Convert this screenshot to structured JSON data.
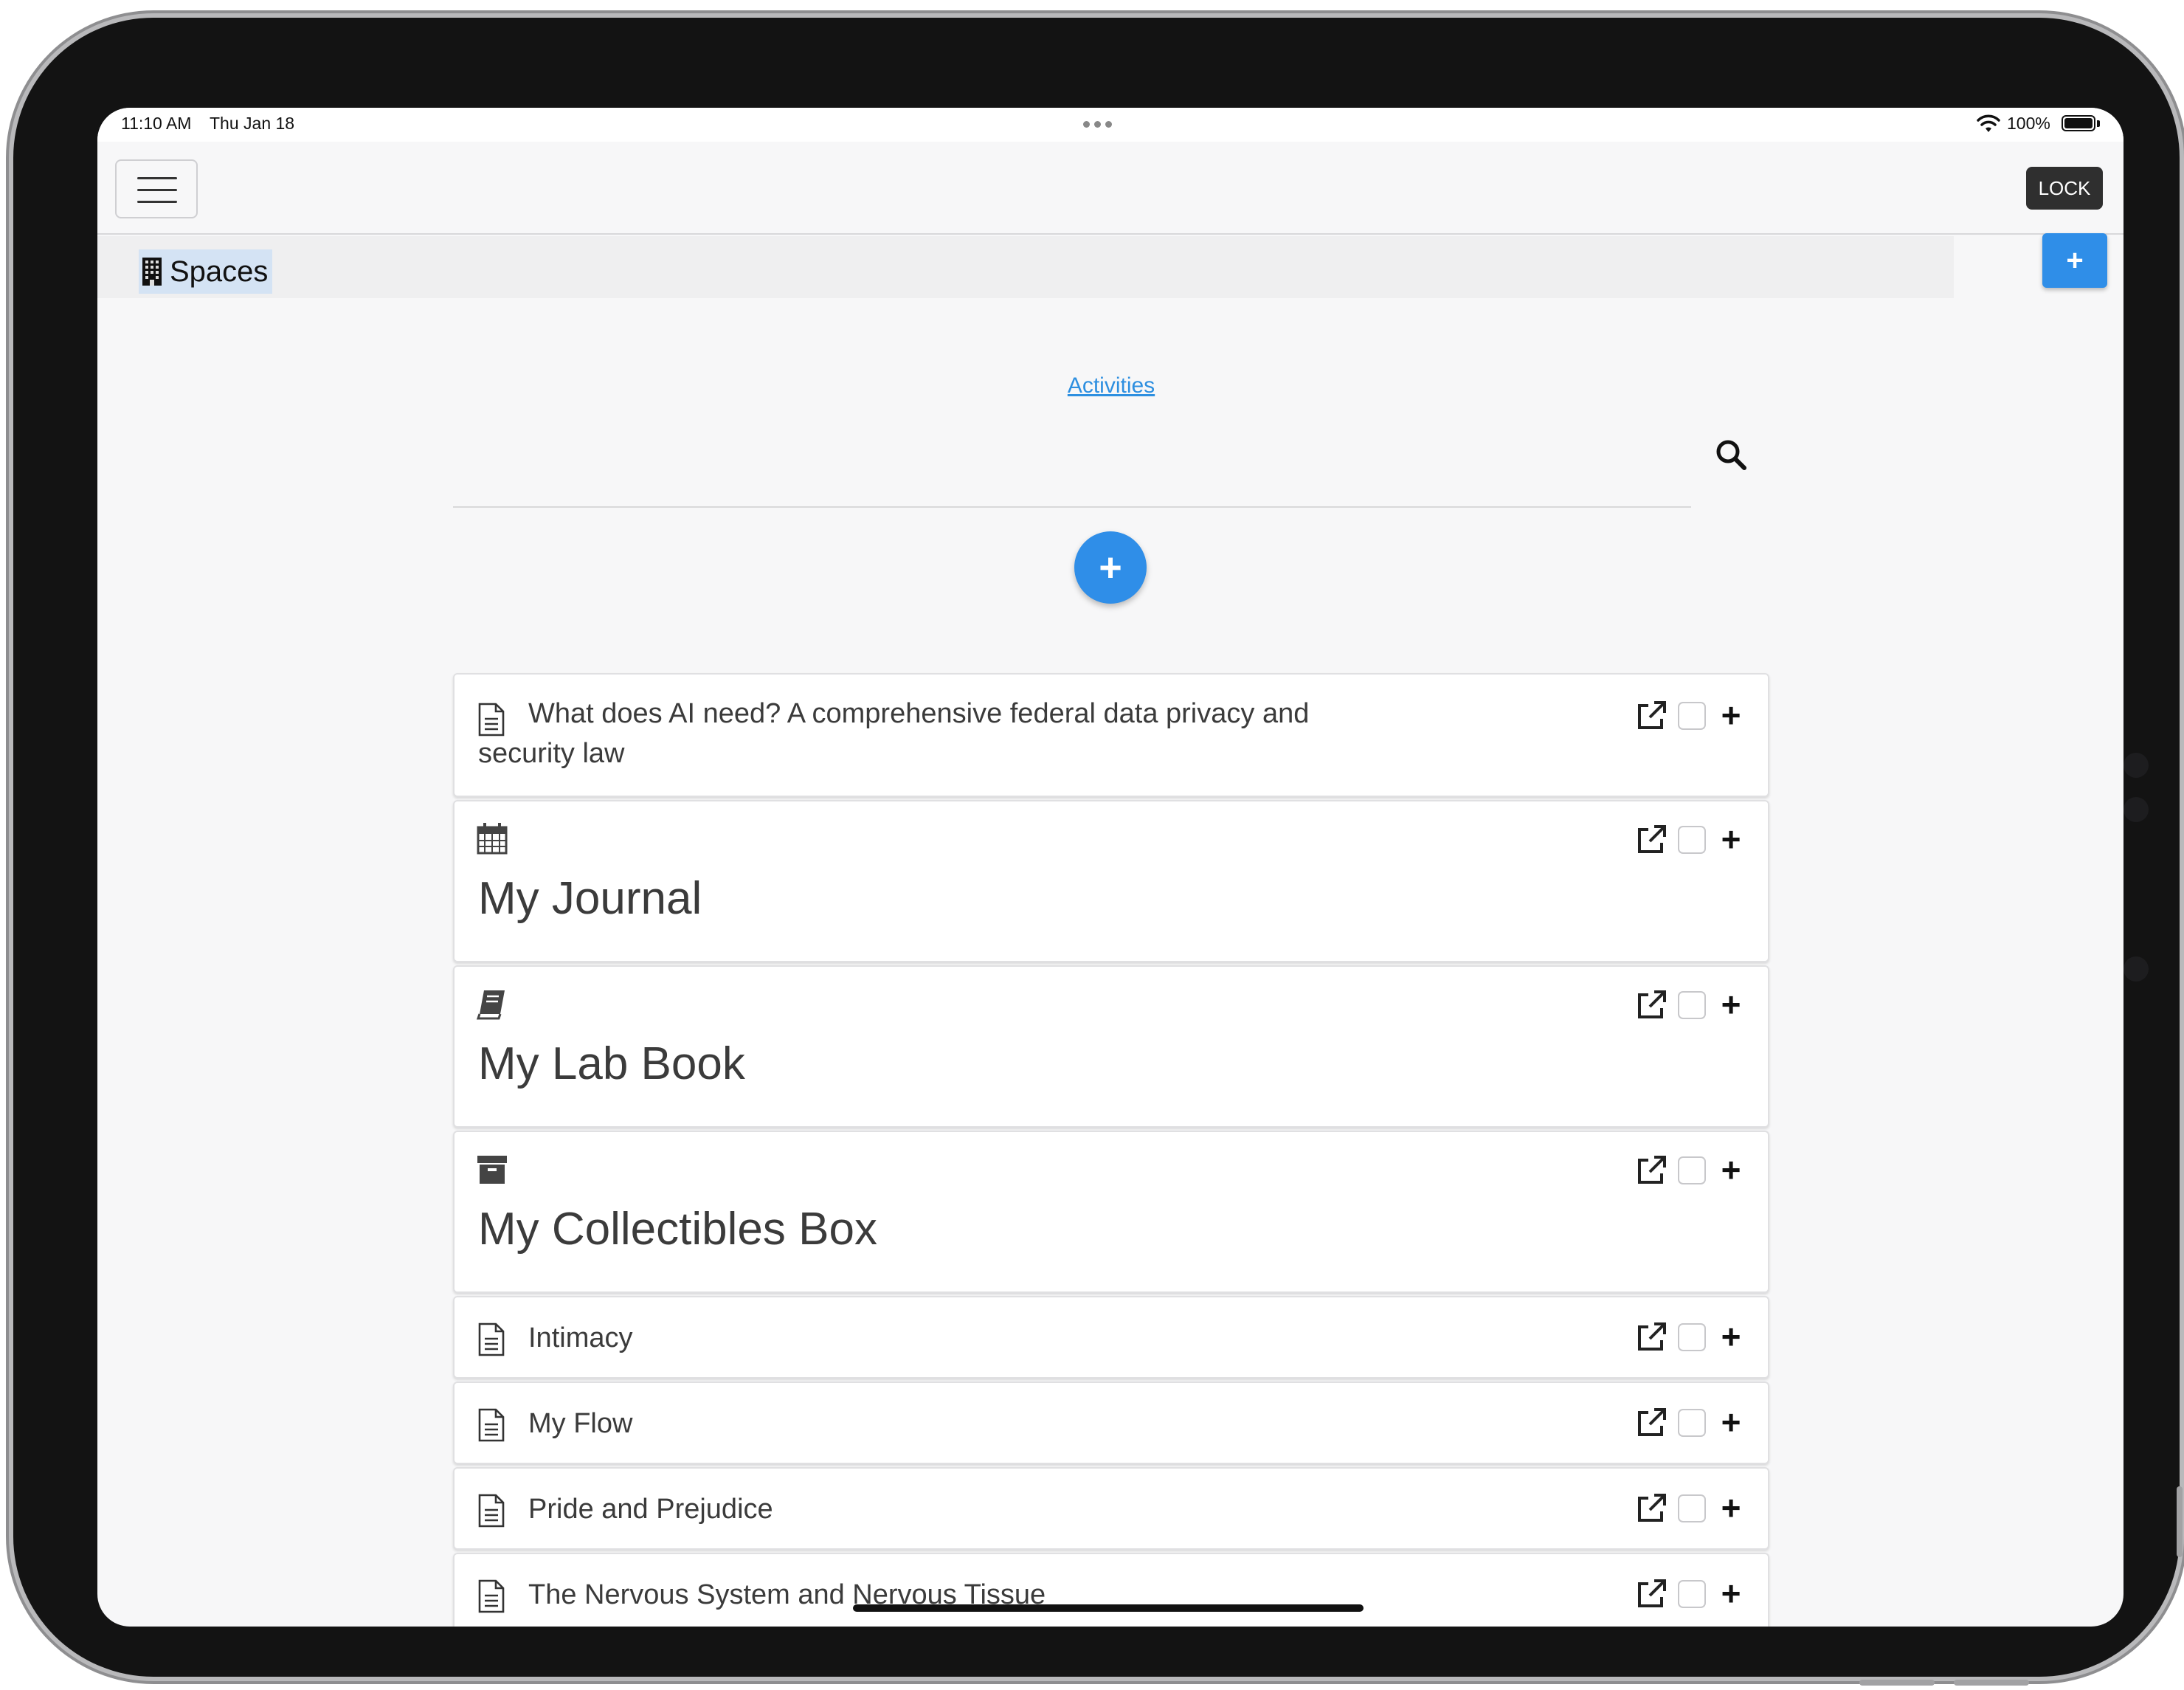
{
  "status_bar": {
    "time": "11:10 AM",
    "date": "Thu Jan 18",
    "battery": "100%",
    "wifi_icon": "wifi-icon",
    "battery_icon": "battery-icon"
  },
  "topbar": {
    "menu_icon": "hamburger-menu-icon",
    "lock_label": "LOCK"
  },
  "spaces": {
    "label": "Spaces",
    "icon": "building-icon",
    "add_label": "+"
  },
  "main": {
    "activities_link": "Activities",
    "search_icon": "search-icon",
    "add_label": "+"
  },
  "items": [
    {
      "type": "document",
      "icon": "document-icon",
      "title": "What does AI need? A comprehensive federal data privacy and security law"
    },
    {
      "type": "space",
      "icon": "calendar-icon",
      "title": "My Journal"
    },
    {
      "type": "space",
      "icon": "book-icon",
      "title": "My Lab Book"
    },
    {
      "type": "space",
      "icon": "archive-box-icon",
      "title": "My Collectibles Box"
    },
    {
      "type": "document",
      "icon": "document-icon",
      "title": "Intimacy"
    },
    {
      "type": "document",
      "icon": "document-icon",
      "title": "My Flow"
    },
    {
      "type": "document",
      "icon": "document-icon",
      "title": "Pride and Prejudice"
    },
    {
      "type": "document",
      "icon": "document-icon",
      "title": "The Nervous System and Nervous Tissue"
    }
  ],
  "item_actions": {
    "open_icon": "external-link-icon",
    "add_label": "+"
  },
  "colors": {
    "accent": "#2f8ee8",
    "lock_bg": "#2f2f2f",
    "spaces_highlight": "#d4e3f4"
  }
}
